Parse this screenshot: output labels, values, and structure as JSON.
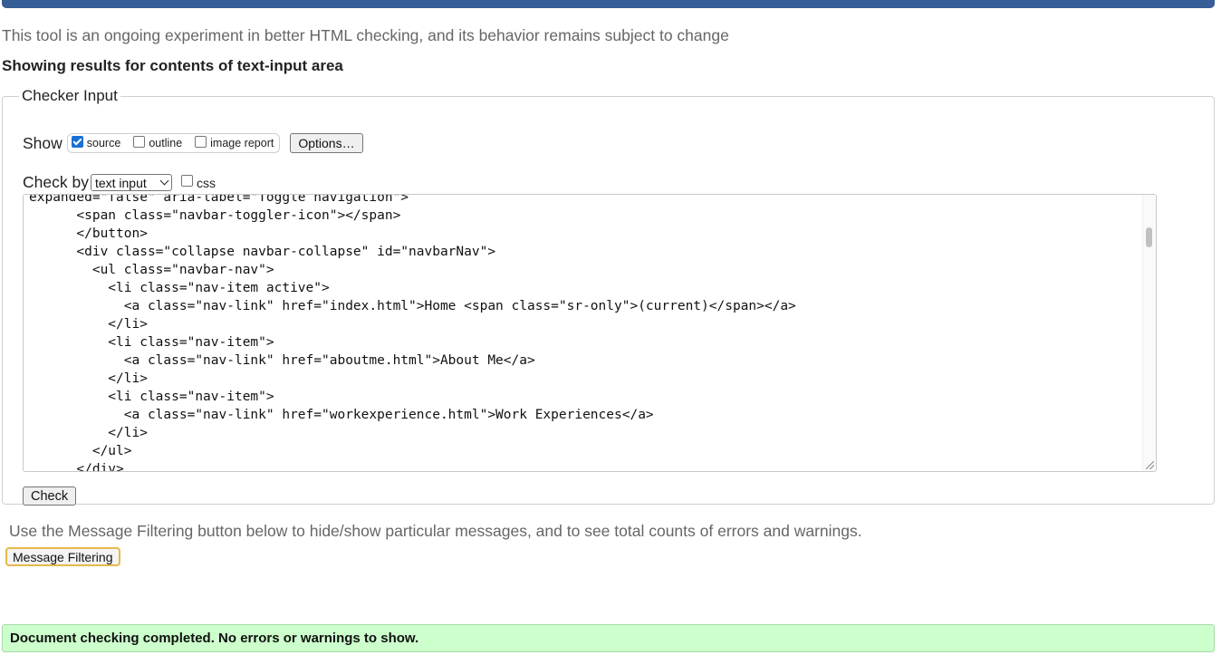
{
  "intro_text": "This tool is an ongoing experiment in better HTML checking, and its behavior remains subject to change",
  "results_heading": "Showing results for contents of text-input area",
  "checker": {
    "legend": "Checker Input",
    "show_label": "Show",
    "options": [
      {
        "label": "source",
        "checked": true
      },
      {
        "label": "outline",
        "checked": false
      },
      {
        "label": "image report",
        "checked": false
      }
    ],
    "options_button": "Options…",
    "check_by_label": "Check by",
    "check_by_value": "text input",
    "css_label": "css",
    "css_checked": false,
    "code_lines": [
      "expanded=\"false\" aria-label=\"Toggle navigation\">",
      "      <span class=\"navbar-toggler-icon\"></span>",
      "      </button>",
      "      <div class=\"collapse navbar-collapse\" id=\"navbarNav\">",
      "        <ul class=\"navbar-nav\">",
      "          <li class=\"nav-item active\">",
      "            <a class=\"nav-link\" href=\"index.html\">Home <span class=\"sr-only\">(current)</span></a>",
      "          </li>",
      "          <li class=\"nav-item\">",
      "            <a class=\"nav-link\" href=\"aboutme.html\">About Me</a>",
      "          </li>",
      "          <li class=\"nav-item\">",
      "            <a class=\"nav-link\" href=\"workexperience.html\">Work Experiences</a>",
      "          </li>",
      "        </ul>",
      "      </div>"
    ],
    "check_button": "Check"
  },
  "filter_note": "Use the Message Filtering button below to hide/show particular messages, and to see total counts of errors and warnings.",
  "filter_button": "Message Filtering",
  "status_message": "Document checking completed. No errors or warnings to show.",
  "colors": {
    "header_bar": "#365d95",
    "success_background": "#ccffcc",
    "filter_button_border": "#e8b84a"
  }
}
